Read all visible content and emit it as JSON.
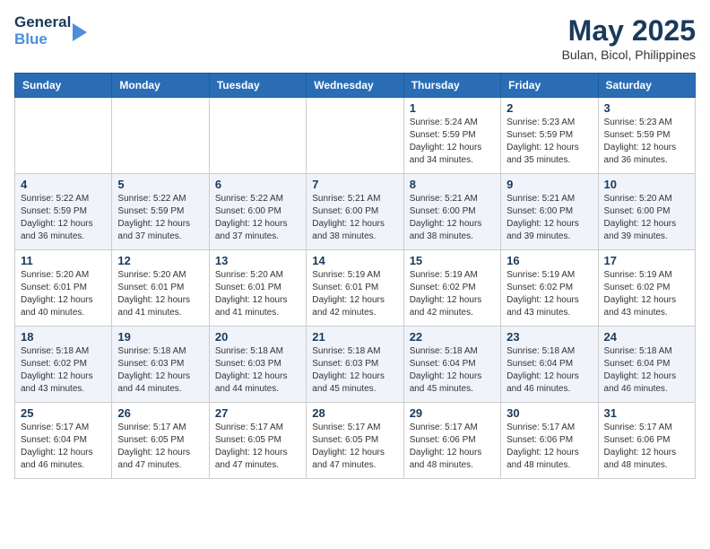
{
  "logo": {
    "line1": "General",
    "line2": "Blue"
  },
  "title": "May 2025",
  "location": "Bulan, Bicol, Philippines",
  "weekdays": [
    "Sunday",
    "Monday",
    "Tuesday",
    "Wednesday",
    "Thursday",
    "Friday",
    "Saturday"
  ],
  "weeks": [
    [
      {
        "day": "",
        "info": ""
      },
      {
        "day": "",
        "info": ""
      },
      {
        "day": "",
        "info": ""
      },
      {
        "day": "",
        "info": ""
      },
      {
        "day": "1",
        "info": "Sunrise: 5:24 AM\nSunset: 5:59 PM\nDaylight: 12 hours\nand 34 minutes."
      },
      {
        "day": "2",
        "info": "Sunrise: 5:23 AM\nSunset: 5:59 PM\nDaylight: 12 hours\nand 35 minutes."
      },
      {
        "day": "3",
        "info": "Sunrise: 5:23 AM\nSunset: 5:59 PM\nDaylight: 12 hours\nand 36 minutes."
      }
    ],
    [
      {
        "day": "4",
        "info": "Sunrise: 5:22 AM\nSunset: 5:59 PM\nDaylight: 12 hours\nand 36 minutes."
      },
      {
        "day": "5",
        "info": "Sunrise: 5:22 AM\nSunset: 5:59 PM\nDaylight: 12 hours\nand 37 minutes."
      },
      {
        "day": "6",
        "info": "Sunrise: 5:22 AM\nSunset: 6:00 PM\nDaylight: 12 hours\nand 37 minutes."
      },
      {
        "day": "7",
        "info": "Sunrise: 5:21 AM\nSunset: 6:00 PM\nDaylight: 12 hours\nand 38 minutes."
      },
      {
        "day": "8",
        "info": "Sunrise: 5:21 AM\nSunset: 6:00 PM\nDaylight: 12 hours\nand 38 minutes."
      },
      {
        "day": "9",
        "info": "Sunrise: 5:21 AM\nSunset: 6:00 PM\nDaylight: 12 hours\nand 39 minutes."
      },
      {
        "day": "10",
        "info": "Sunrise: 5:20 AM\nSunset: 6:00 PM\nDaylight: 12 hours\nand 39 minutes."
      }
    ],
    [
      {
        "day": "11",
        "info": "Sunrise: 5:20 AM\nSunset: 6:01 PM\nDaylight: 12 hours\nand 40 minutes."
      },
      {
        "day": "12",
        "info": "Sunrise: 5:20 AM\nSunset: 6:01 PM\nDaylight: 12 hours\nand 41 minutes."
      },
      {
        "day": "13",
        "info": "Sunrise: 5:20 AM\nSunset: 6:01 PM\nDaylight: 12 hours\nand 41 minutes."
      },
      {
        "day": "14",
        "info": "Sunrise: 5:19 AM\nSunset: 6:01 PM\nDaylight: 12 hours\nand 42 minutes."
      },
      {
        "day": "15",
        "info": "Sunrise: 5:19 AM\nSunset: 6:02 PM\nDaylight: 12 hours\nand 42 minutes."
      },
      {
        "day": "16",
        "info": "Sunrise: 5:19 AM\nSunset: 6:02 PM\nDaylight: 12 hours\nand 43 minutes."
      },
      {
        "day": "17",
        "info": "Sunrise: 5:19 AM\nSunset: 6:02 PM\nDaylight: 12 hours\nand 43 minutes."
      }
    ],
    [
      {
        "day": "18",
        "info": "Sunrise: 5:18 AM\nSunset: 6:02 PM\nDaylight: 12 hours\nand 43 minutes."
      },
      {
        "day": "19",
        "info": "Sunrise: 5:18 AM\nSunset: 6:03 PM\nDaylight: 12 hours\nand 44 minutes."
      },
      {
        "day": "20",
        "info": "Sunrise: 5:18 AM\nSunset: 6:03 PM\nDaylight: 12 hours\nand 44 minutes."
      },
      {
        "day": "21",
        "info": "Sunrise: 5:18 AM\nSunset: 6:03 PM\nDaylight: 12 hours\nand 45 minutes."
      },
      {
        "day": "22",
        "info": "Sunrise: 5:18 AM\nSunset: 6:04 PM\nDaylight: 12 hours\nand 45 minutes."
      },
      {
        "day": "23",
        "info": "Sunrise: 5:18 AM\nSunset: 6:04 PM\nDaylight: 12 hours\nand 46 minutes."
      },
      {
        "day": "24",
        "info": "Sunrise: 5:18 AM\nSunset: 6:04 PM\nDaylight: 12 hours\nand 46 minutes."
      }
    ],
    [
      {
        "day": "25",
        "info": "Sunrise: 5:17 AM\nSunset: 6:04 PM\nDaylight: 12 hours\nand 46 minutes."
      },
      {
        "day": "26",
        "info": "Sunrise: 5:17 AM\nSunset: 6:05 PM\nDaylight: 12 hours\nand 47 minutes."
      },
      {
        "day": "27",
        "info": "Sunrise: 5:17 AM\nSunset: 6:05 PM\nDaylight: 12 hours\nand 47 minutes."
      },
      {
        "day": "28",
        "info": "Sunrise: 5:17 AM\nSunset: 6:05 PM\nDaylight: 12 hours\nand 47 minutes."
      },
      {
        "day": "29",
        "info": "Sunrise: 5:17 AM\nSunset: 6:06 PM\nDaylight: 12 hours\nand 48 minutes."
      },
      {
        "day": "30",
        "info": "Sunrise: 5:17 AM\nSunset: 6:06 PM\nDaylight: 12 hours\nand 48 minutes."
      },
      {
        "day": "31",
        "info": "Sunrise: 5:17 AM\nSunset: 6:06 PM\nDaylight: 12 hours\nand 48 minutes."
      }
    ]
  ]
}
